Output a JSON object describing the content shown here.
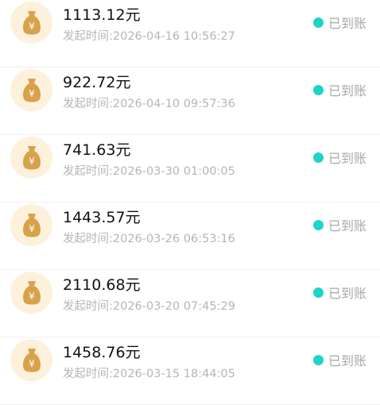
{
  "records": [
    {
      "amount": "1113.12元",
      "time": "发起时间:2026-04-16 10:56:27",
      "status": "已到账"
    },
    {
      "amount": "922.72元",
      "time": "发起时间:2026-04-10 09:57:36",
      "status": "已到账"
    },
    {
      "amount": "741.63元",
      "time": "发起时间:2026-03-30 01:00:05",
      "status": "已到账"
    },
    {
      "amount": "1443.57元",
      "time": "发起时间:2026-03-26 06:53:16",
      "status": "已到账"
    },
    {
      "amount": "2110.68元",
      "time": "发起时间:2026-03-20 07:45:29",
      "status": "已到账"
    },
    {
      "amount": "1458.76元",
      "time": "发起时间:2026-03-15 18:44:05",
      "status": "已到账"
    }
  ],
  "icons": {
    "record_icon": "money-bag-icon",
    "status_icon": "status-dot-icon"
  },
  "colors": {
    "icon_bg": "#fdf1dc",
    "icon_fg": "#d8a24a",
    "status_dot": "#1ed3c9",
    "amount_text": "#111111",
    "muted_text": "#b5b5b5"
  }
}
